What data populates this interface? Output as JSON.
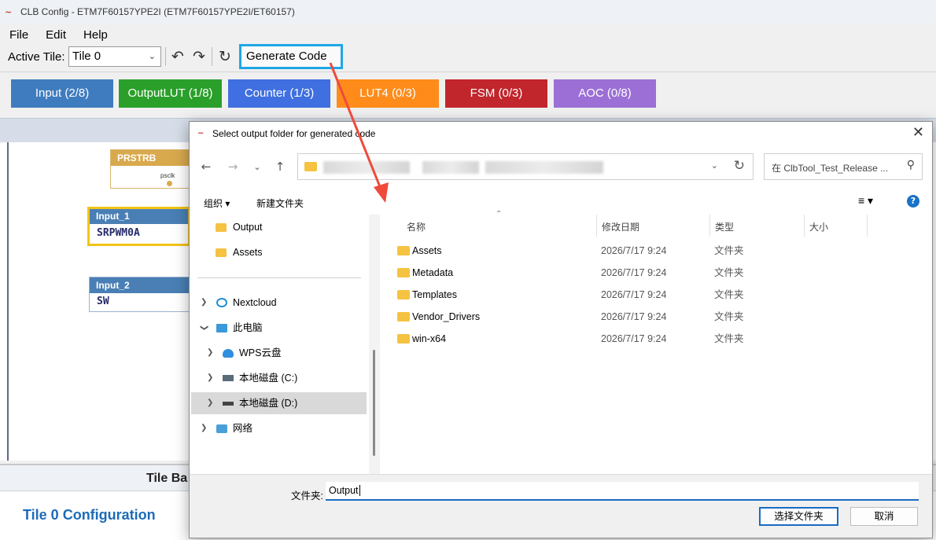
{
  "window": {
    "title": "CLB Config - ETM7F60157YPE2I (ETM7F60157YPE2I/ET60157)"
  },
  "menu": [
    "File",
    "Edit",
    "Help"
  ],
  "toolbar": {
    "active_tile_label": "Active Tile:",
    "tile_value": "Tile 0",
    "generate_label": "Generate Code"
  },
  "categories": [
    {
      "label": "Input (2/8)",
      "color": "#3f7cbf"
    },
    {
      "label": "OutputLUT (1/8)",
      "color": "#2aa02a"
    },
    {
      "label": "Counter (1/3)",
      "color": "#3f6fe0"
    },
    {
      "label": "LUT4 (0/3)",
      "color": "#ff8c1a"
    },
    {
      "label": "FSM (0/3)",
      "color": "#c0262c"
    },
    {
      "label": "AOC (0/8)",
      "color": "#9b6fd6"
    }
  ],
  "canvas": {
    "nodes": [
      {
        "title": "PRSTRB",
        "port": "psclk",
        "value": ""
      },
      {
        "title": "Input_1",
        "value": "SRPWM0A"
      },
      {
        "title": "Input_2",
        "value": "SW"
      }
    ]
  },
  "bottom": {
    "title": "Tile Ba",
    "config_title": "Tile 0 Configuration"
  },
  "dialog": {
    "title": "Select output folder for generated code",
    "search_placeholder": "在 ClbTool_Test_Release ...",
    "organize": "组织",
    "new_folder": "新建文件夹",
    "nav": [
      {
        "label": "Output",
        "icon": "folder-icon"
      },
      {
        "label": "Assets",
        "icon": "folder-icon"
      },
      {
        "label": "Nextcloud",
        "icon": "nextcloud-icon"
      },
      {
        "label": "此电脑",
        "icon": "computer-icon"
      },
      {
        "label": "WPS云盘",
        "icon": "cloud-icon"
      },
      {
        "label": "本地磁盘 (C:)",
        "icon": "drive-icon"
      },
      {
        "label": "本地磁盘 (D:)",
        "icon": "drive-icon"
      },
      {
        "label": "网络",
        "icon": "network-icon"
      }
    ],
    "columns": [
      "名称",
      "修改日期",
      "类型",
      "大小"
    ],
    "files": [
      {
        "name": "Assets",
        "date": "2026/7/17 9:24",
        "type": "文件夹"
      },
      {
        "name": "Metadata",
        "date": "2026/7/17 9:24",
        "type": "文件夹"
      },
      {
        "name": "Templates",
        "date": "2026/7/17 9:24",
        "type": "文件夹"
      },
      {
        "name": "Vendor_Drivers",
        "date": "2026/7/17 9:24",
        "type": "文件夹"
      },
      {
        "name": "win-x64",
        "date": "2026/7/17 9:24",
        "type": "文件夹"
      }
    ],
    "folder_label": "文件夹:",
    "folder_value": "Output",
    "select_button": "选择文件夹",
    "cancel_button": "取消"
  }
}
